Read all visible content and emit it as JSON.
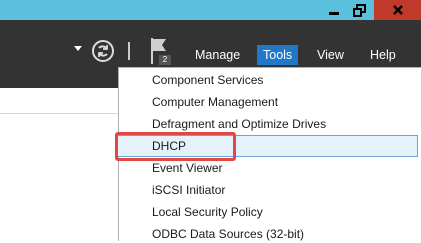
{
  "window": {
    "minimize_icon": "minimize-icon",
    "restore_icon": "restore-icon",
    "close_icon": "close-icon"
  },
  "toolbar": {
    "notifications_count": "2",
    "menus": [
      {
        "label": "Manage"
      },
      {
        "label": "Tools",
        "active": true
      },
      {
        "label": "View"
      },
      {
        "label": "Help"
      }
    ]
  },
  "tools_menu": {
    "items": [
      {
        "label": "Component Services"
      },
      {
        "label": "Computer Management"
      },
      {
        "label": "Defragment and Optimize Drives"
      },
      {
        "label": "DHCP",
        "hovered": true,
        "highlighted": true
      },
      {
        "label": "Event Viewer"
      },
      {
        "label": "iSCSI Initiator"
      },
      {
        "label": "Local Security Policy"
      },
      {
        "label": "ODBC Data Sources (32-bit)"
      }
    ]
  },
  "colors": {
    "titlebar": "#5bc0de",
    "toolbar": "#333333",
    "active_menu": "#1f78c8",
    "close_button": "#c0392b",
    "highlight_box": "#e04848"
  }
}
